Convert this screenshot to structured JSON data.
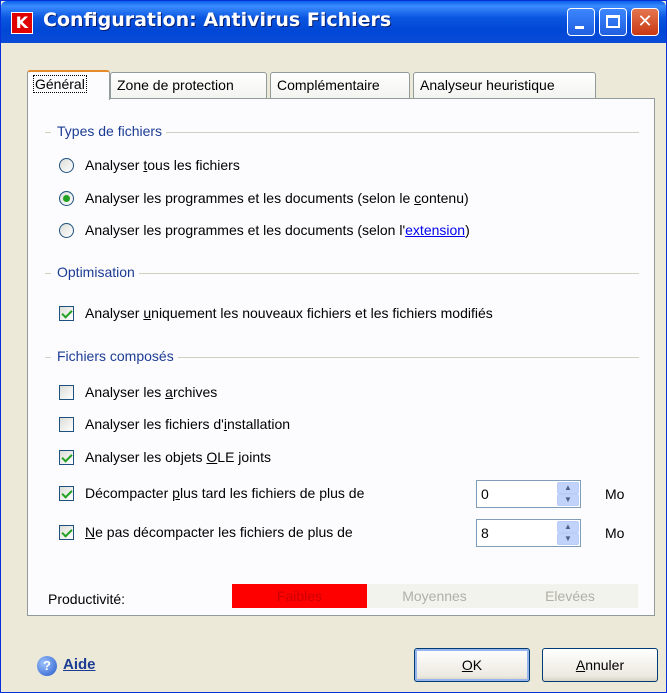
{
  "window": {
    "title": "Configuration: Antivirus Fichiers",
    "app_icon_letter": "K",
    "accent_color": "#0a56e0",
    "controls": {
      "minimize": "minimize",
      "maximize": "maximize",
      "close": "✕"
    }
  },
  "tabs": [
    {
      "label": "Général",
      "active": true
    },
    {
      "label": "Zone de protection",
      "active": false
    },
    {
      "label": "Complémentaire",
      "active": false
    },
    {
      "label": "Analyseur heuristique",
      "active": false
    }
  ],
  "types": {
    "title": "Types de fichiers",
    "options": [
      {
        "pre": "Analyser ",
        "ul": "t",
        "post": "ous les fichiers",
        "selected": false
      },
      {
        "pre": "Analyser les programmes et les documents (selon le ",
        "ul": "c",
        "post": "ontenu)",
        "selected": true
      },
      {
        "pre": "Analyser les programmes et les documents (selon l'",
        "link": "extension",
        "post": ")",
        "selected": false
      }
    ]
  },
  "optimisation": {
    "title": "Optimisation",
    "option": {
      "pre": "Analyser ",
      "ul": "u",
      "post": "niquement les nouveaux fichiers et les fichiers modifiés",
      "checked": true
    }
  },
  "composes": {
    "title": "Fichiers composés",
    "options": [
      {
        "pre": "Analyser les ",
        "ul": "a",
        "post": "rchives",
        "checked": false
      },
      {
        "pre": "Analyser les fichiers d'",
        "ul": "i",
        "post": "nstallation",
        "checked": false
      },
      {
        "pre": "Analyser les objets ",
        "ul": "O",
        "post": "LE joints",
        "checked": true
      },
      {
        "pre": "Décompacter ",
        "ul": "p",
        "post": "lus tard les fichiers de plus de",
        "checked": true,
        "value": "0",
        "unit": "Mo"
      },
      {
        "pre": "",
        "ul": "N",
        "post": "e pas décompacter les fichiers de plus de",
        "checked": true,
        "value": "8",
        "unit": "Mo"
      }
    ]
  },
  "productivity": {
    "label": "Productivité:",
    "levels": [
      "Faibles",
      "Moyennes",
      "Elevées"
    ],
    "selected": "Faibles",
    "colors": {
      "selected_bg": "#ff0000",
      "selected_text": "#cc0000",
      "inactive_bg": "#f3f3ee",
      "inactive_text": "#b0b0a8"
    }
  },
  "footer": {
    "help": "Aide",
    "ok": {
      "ul": "O",
      "post": "K"
    },
    "cancel": {
      "ul": "A",
      "post": "nnuler"
    }
  }
}
